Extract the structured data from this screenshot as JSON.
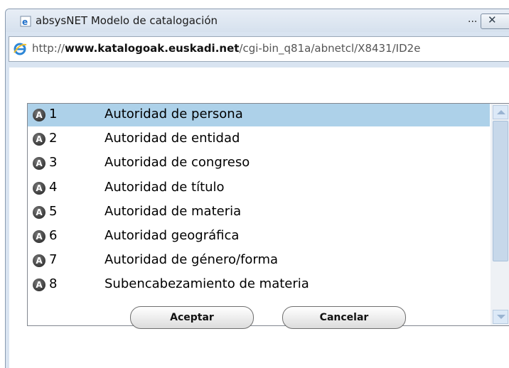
{
  "window": {
    "title": "absysNET Modelo de catalogación",
    "ellipsis": "...",
    "close_symbol": "✕"
  },
  "address": {
    "url_prefix": "http://",
    "url_domain": "www.katalogoak.euskadi.net",
    "url_path": "/cgi-bin_q81a/abnetcl/X8431/ID2e"
  },
  "list": {
    "selected_index": 0,
    "items": [
      {
        "num": "1",
        "label": "Autoridad de persona",
        "icon": "authority-icon"
      },
      {
        "num": "2",
        "label": "Autoridad de entidad",
        "icon": "authority-icon"
      },
      {
        "num": "3",
        "label": "Autoridad de congreso",
        "icon": "authority-icon"
      },
      {
        "num": "4",
        "label": "Autoridad de título",
        "icon": "authority-icon"
      },
      {
        "num": "5",
        "label": "Autoridad de materia",
        "icon": "authority-icon"
      },
      {
        "num": "6",
        "label": "Autoridad geográfica",
        "icon": "authority-icon"
      },
      {
        "num": "7",
        "label": "Autoridad de género/forma",
        "icon": "authority-icon"
      },
      {
        "num": "8",
        "label": "Subencabezamiento de materia",
        "icon": "authority-icon"
      }
    ],
    "icon_letter": "A"
  },
  "buttons": {
    "accept": "Aceptar",
    "cancel": "Cancelar"
  },
  "colors": {
    "selection": "#add1e9",
    "chrome": "#d9e4f1"
  }
}
